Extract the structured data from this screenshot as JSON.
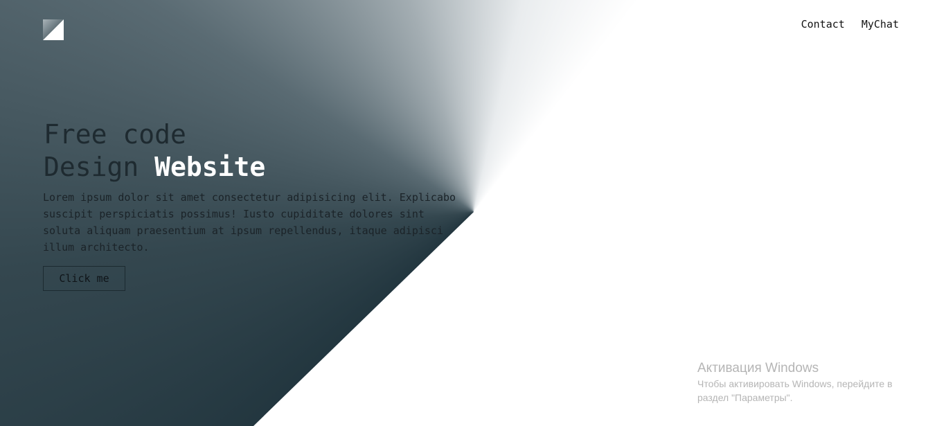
{
  "header": {
    "logo_icon": "square-diagonal-logo-icon",
    "nav": [
      {
        "label": "Contact"
      },
      {
        "label": "MyChat"
      }
    ]
  },
  "hero": {
    "title_line1": "Free code",
    "title_line2_prefix": "Design ",
    "title_line2_highlight": "Website",
    "description": "Lorem ipsum dolor sit amet consectetur adipisicing elit. Explicabo suscipit perspiciatis possimus! Iusto cupiditate dolores sint soluta aliquam praesentium at ipsum repellendus, itaque adipisci illum architecto.",
    "button_label": "Click me"
  },
  "windows_activation": {
    "title": "Активация Windows",
    "text": "Чтобы активировать Windows, перейдите в раздел \"Параметры\"."
  },
  "colors": {
    "dark": "#1f333c",
    "mid": "#5a6b73",
    "highlight": "#ffffff"
  }
}
